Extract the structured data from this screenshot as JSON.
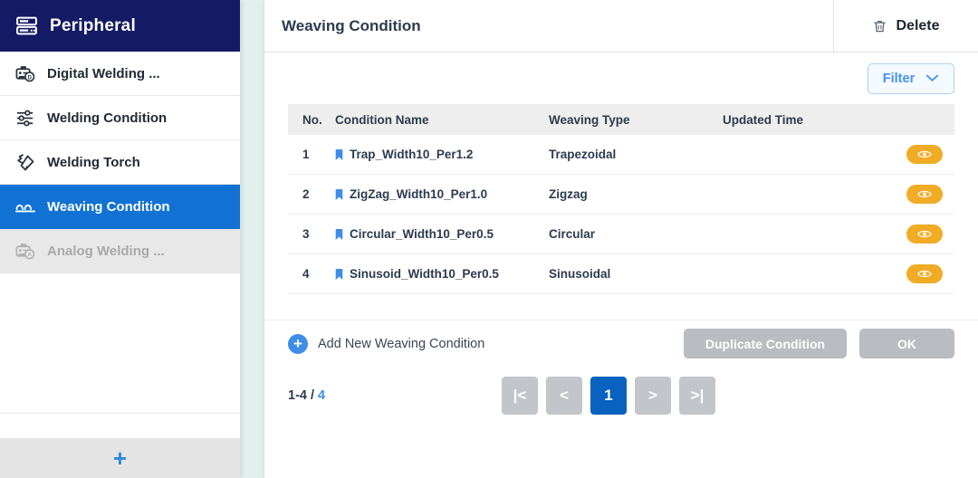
{
  "sidebar": {
    "header": {
      "title": "Peripheral",
      "icon": "server-rack-icon"
    },
    "items": [
      {
        "label": "Digital Welding ...",
        "icon": "digital-welder-icon",
        "state": "normal"
      },
      {
        "label": "Welding Condition",
        "icon": "sliders-icon",
        "state": "normal"
      },
      {
        "label": "Welding Torch",
        "icon": "welding-torch-icon",
        "state": "normal"
      },
      {
        "label": "Weaving Condition",
        "icon": "weaving-wave-icon",
        "state": "active"
      },
      {
        "label": "Analog Welding ...",
        "icon": "analog-welder-icon",
        "state": "disabled"
      }
    ],
    "add_button": {
      "icon": "plus-icon",
      "label": "+"
    }
  },
  "panel": {
    "title": "Weaving Condition",
    "delete": {
      "label": "Delete",
      "icon": "trash-icon"
    },
    "filter": {
      "label": "Filter",
      "icon": "chevron-down-icon"
    },
    "table": {
      "columns": [
        "No.",
        "Condition Name",
        "Weaving Type",
        "Updated Time",
        ""
      ],
      "rows": [
        {
          "no": "1",
          "name": "Trap_Width10_Per1.2",
          "type": "Trapezoidal",
          "updated": "",
          "action_icon": "eye-icon"
        },
        {
          "no": "2",
          "name": "ZigZag_Width10_Per1.0",
          "type": "Zigzag",
          "updated": "",
          "action_icon": "eye-icon"
        },
        {
          "no": "3",
          "name": "Circular_Width10_Per0.5",
          "type": "Circular",
          "updated": "",
          "action_icon": "eye-icon"
        },
        {
          "no": "4",
          "name": "Sinusoid_Width10_Per0.5",
          "type": "Sinusoidal",
          "updated": "",
          "action_icon": "eye-icon"
        }
      ]
    },
    "actions": {
      "add_new_label": "Add New Weaving Condition",
      "duplicate_label": "Duplicate Condition",
      "ok_label": "OK"
    },
    "pagination": {
      "range": "1-4 / ",
      "total": "4",
      "first": "|<",
      "prev": "<",
      "current_page": "1",
      "next": ">",
      "last": ">|"
    }
  },
  "colors": {
    "sidebar_header_bg": "#141a63",
    "active_item_bg": "#1172d4",
    "accent_blue": "#3d8ee8",
    "action_amber": "#f0ac25",
    "disabled_gray": "#b9bcc0",
    "page_bg": "#e3efec"
  }
}
